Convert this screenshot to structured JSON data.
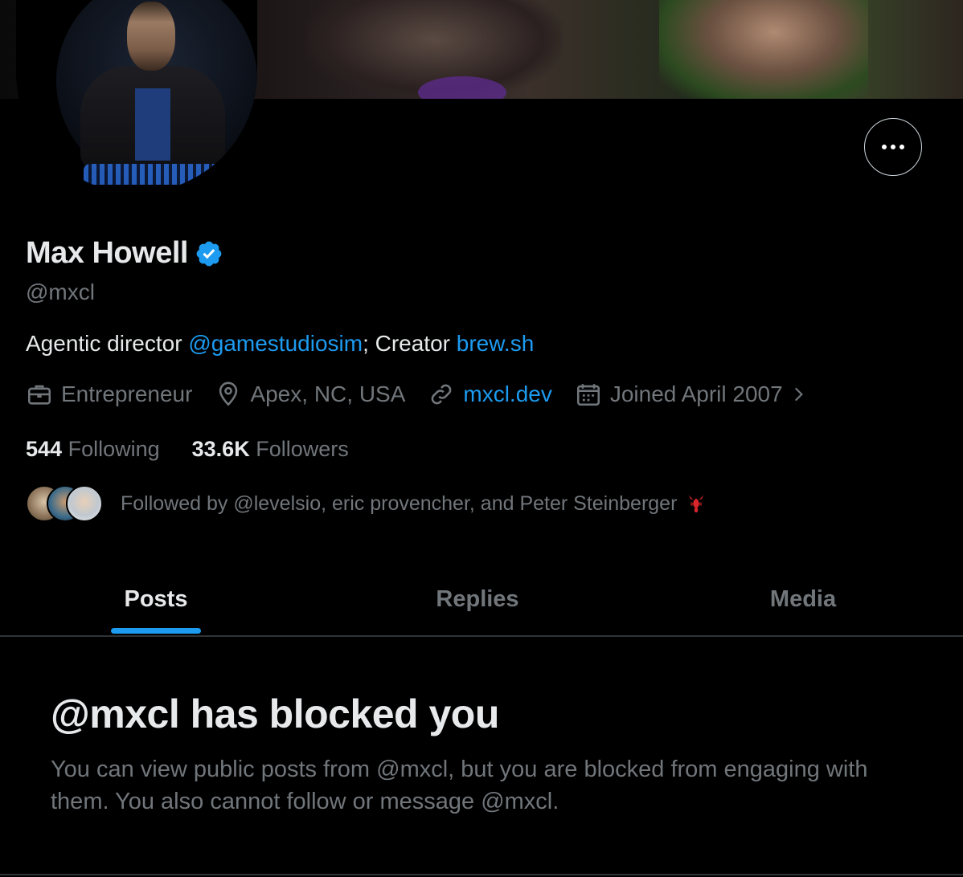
{
  "profile": {
    "name": "Max Howell",
    "handle": "@mxcl",
    "bio": {
      "prefix": "Agentic director ",
      "mention": "@gamestudiosim",
      "middle": "; Creator ",
      "link": "brew.sh"
    },
    "meta": {
      "profession": "Entrepreneur",
      "location": "Apex, NC, USA",
      "website": "mxcl.dev",
      "joined": "Joined April 2007"
    },
    "stats": {
      "following_count": "544",
      "following_label": "Following",
      "followers_count": "33.6K",
      "followers_label": "Followers"
    },
    "followed_by": "Followed by @levelsio, eric provencher, and Peter Steinberger"
  },
  "tabs": [
    {
      "label": "Posts",
      "active": true
    },
    {
      "label": "Replies",
      "active": false
    },
    {
      "label": "Media",
      "active": false
    }
  ],
  "blocked": {
    "title": "@mxcl has blocked you",
    "description": "You can view public posts from @mxcl, but you are blocked from engaging with them. You also cannot follow or message @mxcl."
  },
  "icons": {
    "more": "more-horizontal-icon",
    "verified": "verified-badge-icon",
    "profession": "briefcase-icon",
    "location": "location-pin-icon",
    "website": "link-icon",
    "joined": "calendar-icon",
    "lobster": "lobster-icon"
  },
  "colors": {
    "accent": "#1d9bf0",
    "background": "#000000",
    "text_primary": "#e7e9ea",
    "text_secondary": "#71767b",
    "divider": "#2f3336"
  }
}
